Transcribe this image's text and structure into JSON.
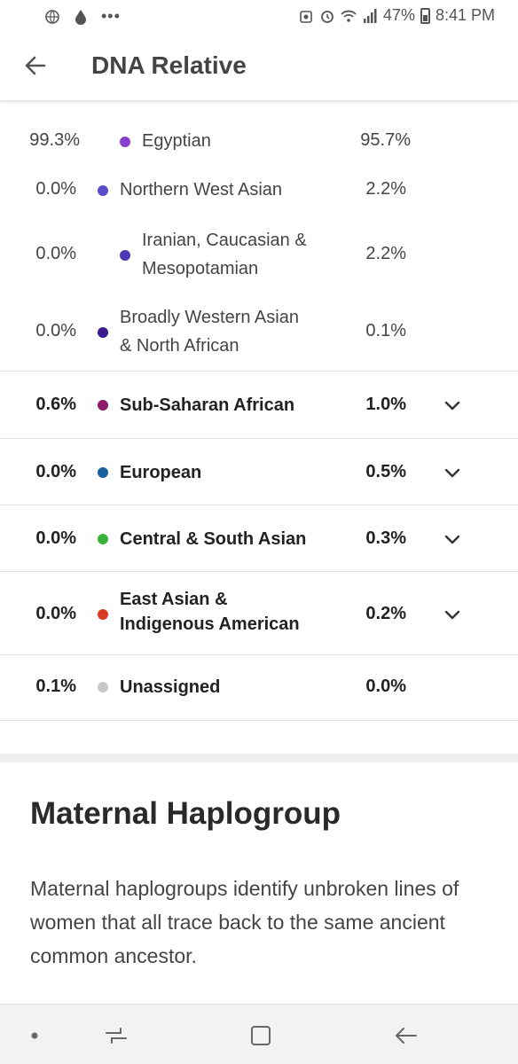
{
  "status_bar": {
    "battery": "47%",
    "time": "8:41 PM",
    "left_icons": [
      "globe-icon",
      "drop-icon",
      "more-dots-icon"
    ],
    "right_icons": [
      "alarm-icon",
      "wifi-icon",
      "signal-icon",
      "battery-icon"
    ]
  },
  "header": {
    "title": "DNA Relative",
    "back_icon": "arrow-left-icon"
  },
  "rows": [
    {
      "left": "99.3%",
      "label": "Egyptian",
      "right": "95.7%",
      "color": "#8b3fd1",
      "bold": false,
      "expandable": false
    },
    {
      "left": "0.0%",
      "label": "Northern West Asian",
      "right": "2.2%",
      "color": "#5b4cc9",
      "bold": false,
      "expandable": false
    },
    {
      "left": "0.0%",
      "label_line1": "Iranian, Caucasian &",
      "label_line2": "Mesopotamian",
      "right": "2.2%",
      "color": "#4a3ab5",
      "bold": false,
      "expandable": false
    },
    {
      "left": "0.0%",
      "label_line1": "Broadly Western Asian",
      "label_line2": "& North African",
      "right": "0.1%",
      "color": "#3a1a8c",
      "bold": false,
      "expandable": false
    },
    {
      "left": "0.6%",
      "label": "Sub-Saharan African",
      "right": "1.0%",
      "color": "#8e1a6b",
      "bold": true,
      "expandable": true
    },
    {
      "left": "0.0%",
      "label": "European",
      "right": "0.5%",
      "color": "#1b5fa0",
      "bold": true,
      "expandable": true
    },
    {
      "left": "0.0%",
      "label": "Central & South Asian",
      "right": "0.3%",
      "color": "#3bb33b",
      "bold": true,
      "expandable": true
    },
    {
      "left": "0.0%",
      "label_line1": "East Asian &",
      "label_line2": "Indigenous American",
      "right": "0.2%",
      "color": "#d63a22",
      "bold": true,
      "expandable": true
    },
    {
      "left": "0.1%",
      "label": "Unassigned",
      "right": "0.0%",
      "color": "#c7c7c7",
      "bold": true,
      "expandable": false
    }
  ],
  "maternal": {
    "title": "Maternal Haplogroup",
    "description": "Maternal haplogroups identify unbroken lines of women that all trace back to the same ancient common ancestor."
  },
  "nav": {
    "items": [
      "dot-icon",
      "recent-apps-icon",
      "home-icon",
      "back-icon"
    ]
  }
}
